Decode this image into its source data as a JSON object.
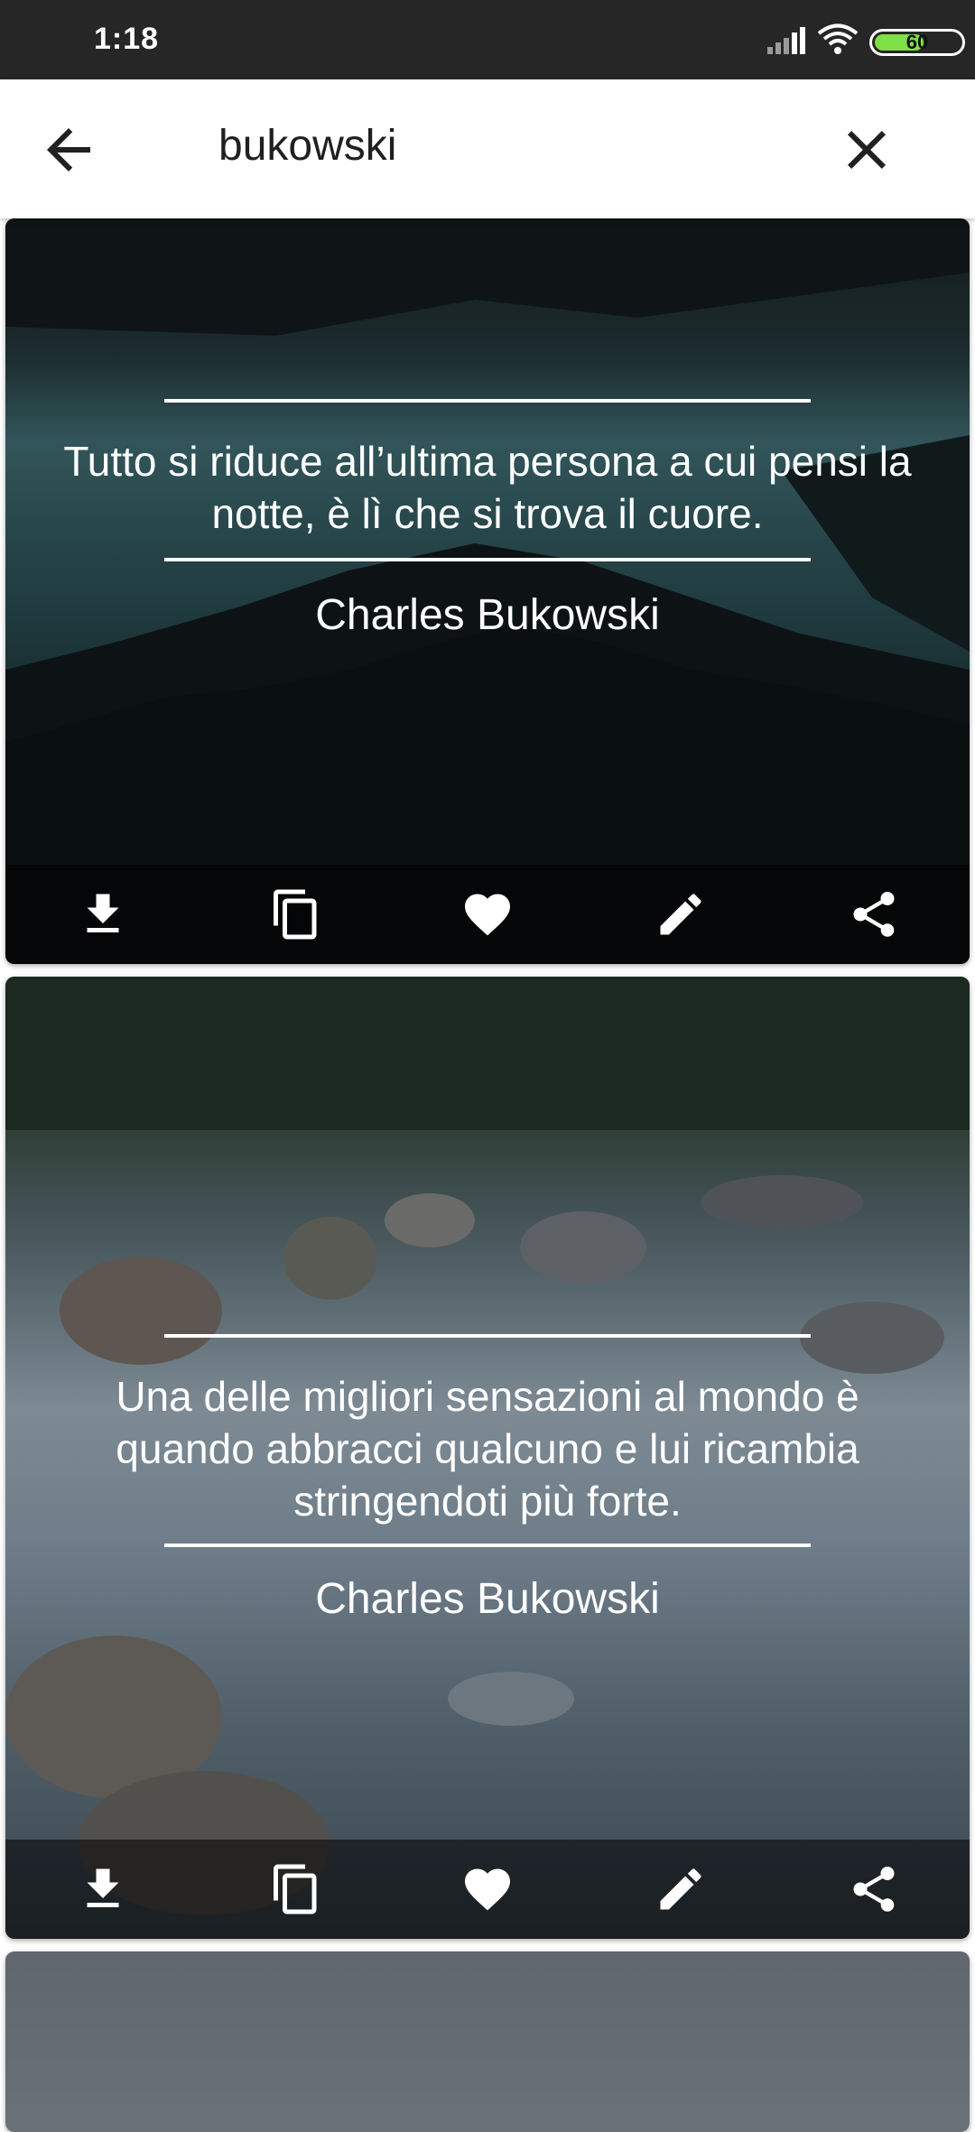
{
  "status_bar": {
    "time": "1:18",
    "battery": "60",
    "battery_level": 0.6,
    "icons": [
      "signal-icon",
      "wifi-icon",
      "battery-icon"
    ]
  },
  "search": {
    "query": "bukowski",
    "back_icon": "arrow-back-icon",
    "clear_icon": "close-icon"
  },
  "cards": [
    {
      "quote": "Tutto si riduce all’ultima persona a cui pensi la notte, è lì che si trova il cuore.",
      "author": "Charles Bukowski"
    },
    {
      "quote": "Una delle migliori sensazioni al mondo è quando abbracci qualcuno e lui ricambia stringendoti più forte.",
      "author": "Charles Bukowski"
    }
  ],
  "card_actions": [
    "download-icon",
    "copy-icon",
    "heart-icon",
    "edit-icon",
    "share-icon"
  ],
  "colors": {
    "status_bar": "#262626",
    "app_bar": "#ffffff",
    "battery_fill": "#7ee045",
    "text_on_image": "#ffffff"
  }
}
